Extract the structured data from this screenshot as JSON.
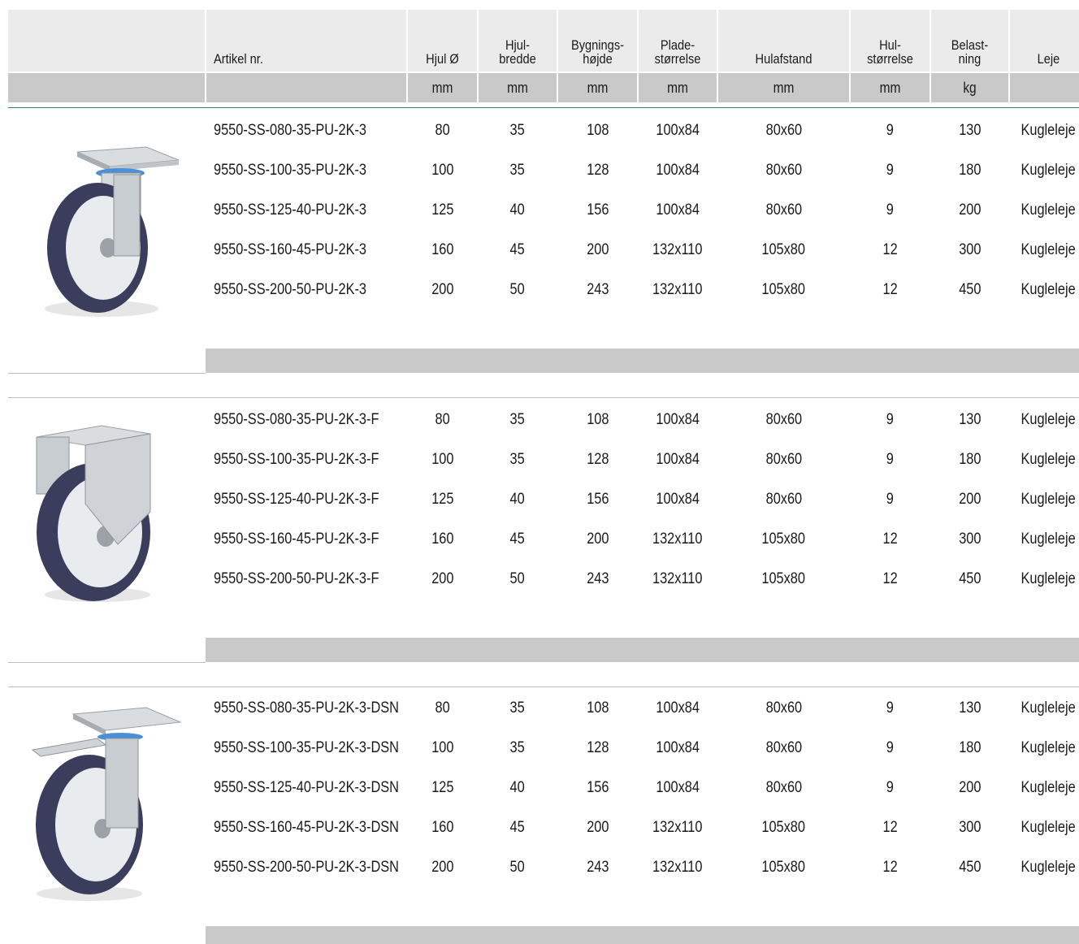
{
  "header": {
    "columns": [
      {
        "key": "artikel",
        "label": "Artikel nr.",
        "unit": ""
      },
      {
        "key": "hjul",
        "label": "Hjul Ø",
        "unit": "mm"
      },
      {
        "key": "bredde",
        "label": "Hjul-\nbredde",
        "unit": "mm"
      },
      {
        "key": "hoejde",
        "label": "Bygnings-\nhøjde",
        "unit": "mm"
      },
      {
        "key": "plade",
        "label": "Plade-\nstørrelse",
        "unit": "mm"
      },
      {
        "key": "hulafstand",
        "label": "Hulafstand",
        "unit": "mm"
      },
      {
        "key": "hul",
        "label": "Hul-\nstørrelse",
        "unit": "mm"
      },
      {
        "key": "belast",
        "label": "Belast-\nning",
        "unit": "kg"
      },
      {
        "key": "leje",
        "label": "Leje",
        "unit": ""
      }
    ]
  },
  "groups": [
    {
      "image": "swivel-castor-icon",
      "rows": [
        [
          "9550-SS-080-35-PU-2K-3",
          "80",
          "35",
          "108",
          "100x84",
          "80x60",
          "9",
          "130",
          "Kugleleje"
        ],
        [
          "9550-SS-100-35-PU-2K-3",
          "100",
          "35",
          "128",
          "100x84",
          "80x60",
          "9",
          "180",
          "Kugleleje"
        ],
        [
          "9550-SS-125-40-PU-2K-3",
          "125",
          "40",
          "156",
          "100x84",
          "80x60",
          "9",
          "200",
          "Kugleleje"
        ],
        [
          "9550-SS-160-45-PU-2K-3",
          "160",
          "45",
          "200",
          "132x110",
          "105x80",
          "12",
          "300",
          "Kugleleje"
        ],
        [
          "9550-SS-200-50-PU-2K-3",
          "200",
          "50",
          "243",
          "132x110",
          "105x80",
          "12",
          "450",
          "Kugleleje"
        ]
      ]
    },
    {
      "image": "fixed-castor-icon",
      "rows": [
        [
          "9550-SS-080-35-PU-2K-3-F",
          "80",
          "35",
          "108",
          "100x84",
          "80x60",
          "9",
          "130",
          "Kugleleje"
        ],
        [
          "9550-SS-100-35-PU-2K-3-F",
          "100",
          "35",
          "128",
          "100x84",
          "80x60",
          "9",
          "180",
          "Kugleleje"
        ],
        [
          "9550-SS-125-40-PU-2K-3-F",
          "125",
          "40",
          "156",
          "100x84",
          "80x60",
          "9",
          "200",
          "Kugleleje"
        ],
        [
          "9550-SS-160-45-PU-2K-3-F",
          "160",
          "45",
          "200",
          "132x110",
          "105x80",
          "12",
          "300",
          "Kugleleje"
        ],
        [
          "9550-SS-200-50-PU-2K-3-F",
          "200",
          "50",
          "243",
          "132x110",
          "105x80",
          "12",
          "450",
          "Kugleleje"
        ]
      ]
    },
    {
      "image": "swivel-castor-with-brake-icon",
      "rows": [
        [
          "9550-SS-080-35-PU-2K-3-DSN",
          "80",
          "35",
          "108",
          "100x84",
          "80x60",
          "9",
          "130",
          "Kugleleje"
        ],
        [
          "9550-SS-100-35-PU-2K-3-DSN",
          "100",
          "35",
          "128",
          "100x84",
          "80x60",
          "9",
          "180",
          "Kugleleje"
        ],
        [
          "9550-SS-125-40-PU-2K-3-DSN",
          "125",
          "40",
          "156",
          "100x84",
          "80x60",
          "9",
          "200",
          "Kugleleje"
        ],
        [
          "9550-SS-160-45-PU-2K-3-DSN",
          "160",
          "45",
          "200",
          "132x110",
          "105x80",
          "12",
          "300",
          "Kugleleje"
        ],
        [
          "9550-SS-200-50-PU-2K-3-DSN",
          "200",
          "50",
          "243",
          "132x110",
          "105x80",
          "12",
          "450",
          "Kugleleje"
        ]
      ]
    }
  ],
  "colors": {
    "header_bg": "#ebebeb",
    "unit_bg": "#c9c9c9",
    "accent_line": "#2e8b57",
    "tyre": "#3a3d5c",
    "hub": "#e8ecef"
  }
}
